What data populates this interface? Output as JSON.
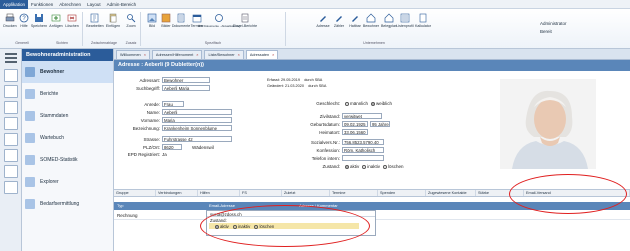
{
  "menu": [
    "Applikation",
    "Funktionen",
    "Abrechnen",
    "Layout",
    "Admin-Bereich"
  ],
  "ribbon": {
    "buttons": [
      "Drucken",
      "Hilfe",
      "Speichern",
      "Anfügen",
      "Löschen",
      "Bearbeiten",
      "Einfügen",
      "Zoom",
      "Bild",
      "Bilder",
      "Dokumente",
      "Termine",
      "IDS Dokumente - Aktualisierung",
      "Einzel-Berichte",
      "Adresse",
      "Zähler",
      "Haltbar",
      "Bewohner",
      "Belegplan",
      "Listenprofil",
      "Kalkulator"
    ],
    "groups": [
      "Generell",
      "Sichten",
      "Zwischenablage",
      "Zusatz",
      "Spezifisch",
      "Unternehmen"
    ]
  },
  "admin": {
    "user": "Administrator",
    "mode": "Bereit"
  },
  "nav": {
    "title": "Bewohneradministration",
    "items": [
      "Bewohner",
      "Berichte",
      "Stammdaten",
      "Wartebuch",
      "SOMED-Statistik",
      "Explorer",
      "Bedarfsermittlung"
    ]
  },
  "tabs": [
    "Willkommen",
    "Adressen/Hilfenoment",
    "Liste/Bewohner",
    "Adressaten"
  ],
  "record": {
    "title": "Adresse : Aeberli (9 Dubletter(n))",
    "adressart_label": "Adressart:",
    "adressart": "Bewohner",
    "suchbegriff_label": "Suchbegriff:",
    "suchbegriff": "Aeberli Maria",
    "erfasst_label": "Erfasst:",
    "erfasst_date": "29.05.2019",
    "erfasst_by": "durch SBA",
    "geandert_label": "Geändert:",
    "geandert_date": "21.03.2020",
    "geandert_by": "durch SBA",
    "anrede_label": "Anrede:",
    "anrede": "Frau",
    "name_label": "Name:",
    "name": "Aeberli",
    "vorname_label": "Vorname:",
    "vorname": "Maria",
    "bezeichnung_label": "Bezeichnung:",
    "bezeichnung": "Krankenheim Sonnenblume",
    "strasse_label": "Strasse:",
    "strasse": "Fuhrstrasse 42",
    "plz_label": "PLZ/Ort:",
    "plz": "8620",
    "ort": "Wädenswil",
    "epd_label": "EPD Registriert:",
    "epd": "Ja",
    "geschlecht_label": "Geschlecht:",
    "geschlecht_opt1": "männlich",
    "geschlecht_opt2": "weiblich",
    "zivilstand_label": "Zivilstand:",
    "zivilstand": "verwitwet",
    "geburtsdatum_label": "Geburtsdatum:",
    "geburtsdatum": "09.02.1925",
    "alter": "95 Jahre",
    "heimatort_label": "Heimatort:",
    "heimatort": "33.06.1560",
    "sozial_label": "Sozialvers.Nr.:",
    "sozial": "756.8523.5790.40",
    "konfession_label": "Konfession:",
    "konfession": "Röm. Katholisch",
    "telefon_label": "Telefon intern:",
    "telefon": "",
    "zustand_label": "Zustand:",
    "zustand_opt1": "aktiv",
    "zustand_opt2": "inaktiv",
    "zustand_opt3": "löschen"
  },
  "table_tabs": [
    "Gruppe",
    "Verbindungen",
    "Hilfen",
    "FS",
    "Zuletzt",
    "Termine",
    "Spenden",
    "Zugewiesene Kontakte",
    "Stärke",
    "Email-Versand"
  ],
  "grid": {
    "headers": [
      "Typ",
      "Email-Adresse",
      "Adresse / Kommentar"
    ],
    "row_type": "Rechnung"
  },
  "editor": {
    "email": "sveta@zdoss.ch",
    "zustand_label": "Zustand:",
    "opt1": "aktiv",
    "opt2": "inaktiv",
    "opt3": "löschen"
  }
}
